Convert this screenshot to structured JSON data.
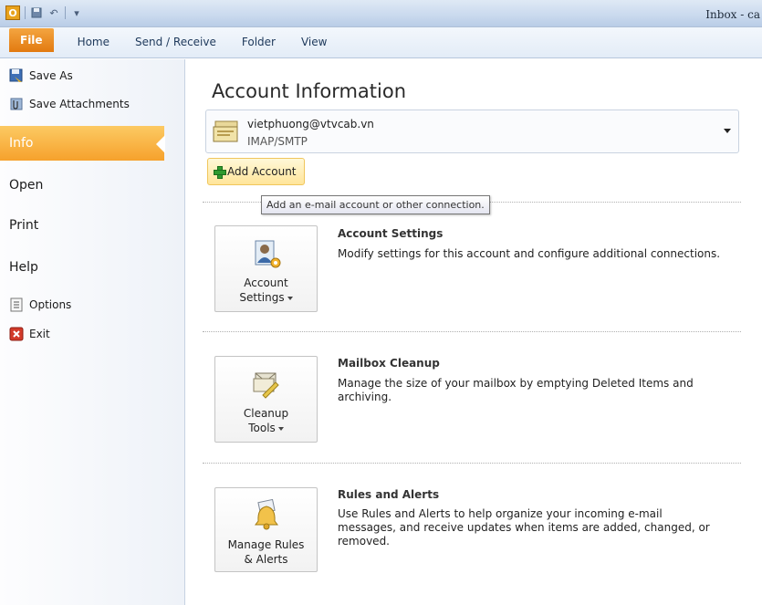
{
  "window": {
    "title": "Inbox - ca",
    "app_icon_letter": "O"
  },
  "ribbon": {
    "tabs": [
      {
        "label": "File",
        "active": true
      },
      {
        "label": "Home"
      },
      {
        "label": "Send / Receive"
      },
      {
        "label": "Folder"
      },
      {
        "label": "View"
      }
    ]
  },
  "backstage_nav": {
    "save_as": "Save As",
    "save_attachments": "Save Attachments",
    "info": "Info",
    "open": "Open",
    "print": "Print",
    "help": "Help",
    "options": "Options",
    "exit": "Exit",
    "active_item": "Info"
  },
  "main": {
    "title": "Account Information",
    "account": {
      "email": "vietphuong@vtvcab.vn",
      "type": "IMAP/SMTP"
    },
    "add_account_label": "Add Account",
    "tooltip": "Add an e-mail account or other connection.",
    "sections": [
      {
        "button_line1": "Account",
        "button_line2": "Settings",
        "title": "Account Settings",
        "description": "Modify settings for this account and configure additional connections."
      },
      {
        "button_line1": "Cleanup",
        "button_line2": "Tools",
        "title": "Mailbox Cleanup",
        "description": "Manage the size of your mailbox by emptying Deleted Items and archiving."
      },
      {
        "button_line1": "Manage Rules",
        "button_line2": "& Alerts",
        "title": "Rules and Alerts",
        "description": "Use Rules and Alerts to help organize your incoming e-mail messages, and receive updates when items are added, changed, or removed."
      }
    ]
  },
  "colors": {
    "file_tab": "#e27a10",
    "active_nav": "#f6a12c",
    "add_account_bg": "#ffe59a"
  }
}
